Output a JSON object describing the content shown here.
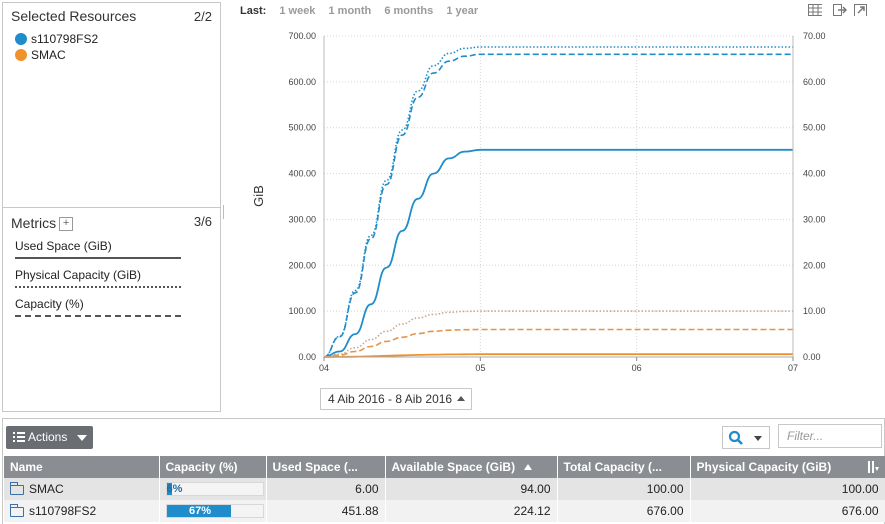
{
  "resources": {
    "title": "Selected Resources",
    "count": "2/2",
    "items": [
      {
        "label": "s110798FS2",
        "color": "#1f8dcc"
      },
      {
        "label": "SMAC",
        "color": "#f0922b"
      }
    ]
  },
  "metrics": {
    "title": "Metrics",
    "count": "3/6",
    "items": [
      {
        "label": "Used Space (GiB)",
        "style": "solid"
      },
      {
        "label": "Physical Capacity (GiB)",
        "style": "dotted"
      },
      {
        "label": "Capacity (%)",
        "style": "dashed"
      }
    ]
  },
  "timerange": {
    "label": "Last:",
    "options": [
      "1 week",
      "1 month",
      "6 months",
      "1 year"
    ]
  },
  "toolbar_icons": [
    "table-view-icon",
    "export-icon",
    "popout-icon"
  ],
  "date_range": "4 Aib 2016 - 8 Aib 2016",
  "chart_data": {
    "type": "line",
    "ylabel_left": "GiB",
    "ylabel_right": "%",
    "ylim_left": [
      0,
      700
    ],
    "ylim_right": [
      0,
      70
    ],
    "yticks_left": [
      "0.00",
      "100.00",
      "200.00",
      "300.00",
      "400.00",
      "500.00",
      "600.00",
      "700.00"
    ],
    "yticks_right": [
      "0.00",
      "10.00",
      "20.00",
      "30.00",
      "40.00",
      "50.00",
      "60.00",
      "70.00"
    ],
    "x_ticks": [
      "04",
      "05",
      "06",
      "07"
    ],
    "x": [
      4.0,
      4.1,
      4.2,
      4.3,
      4.4,
      4.5,
      4.6,
      4.7,
      4.8,
      4.9,
      5.0,
      7.0
    ],
    "series": [
      {
        "resource": "s110798FS2",
        "metric": "Used Space (GiB)",
        "axis": "left",
        "color": "#1f8dcc",
        "dash": "solid",
        "values": [
          0,
          12,
          50,
          115,
          195,
          275,
          345,
          400,
          433,
          448,
          451.88,
          451.88
        ]
      },
      {
        "resource": "s110798FS2",
        "metric": "Physical Capacity (GiB)",
        "axis": "left",
        "color": "#1f8dcc",
        "dash": "dotted",
        "values": [
          0,
          45,
          145,
          265,
          385,
          495,
          580,
          635,
          662,
          673,
          676,
          676
        ]
      },
      {
        "resource": "s110798FS2",
        "metric": "Capacity (%)",
        "axis": "right",
        "color": "#1f8dcc",
        "dash": "dashed",
        "values": [
          0,
          4.4,
          14,
          25.8,
          37.6,
          48.4,
          56.6,
          61.9,
          64.5,
          65.6,
          66,
          66
        ]
      },
      {
        "resource": "SMAC",
        "metric": "Used Space (GiB)",
        "axis": "left",
        "color": "#f0922b",
        "dash": "solid",
        "values": [
          0,
          0.2,
          0.6,
          1.5,
          2.6,
          3.7,
          4.6,
          5.3,
          5.7,
          5.95,
          6,
          6
        ]
      },
      {
        "resource": "SMAC",
        "metric": "Physical Capacity (GiB)",
        "axis": "left",
        "color": "#c9a990",
        "dash": "dotted",
        "values": [
          0,
          6,
          20,
          38,
          56,
          72,
          85,
          93,
          97.5,
          99.4,
          100,
          100
        ]
      },
      {
        "resource": "SMAC",
        "metric": "Capacity (%)",
        "axis": "right",
        "color": "#e8934a",
        "dash": "dashed",
        "values": [
          0,
          0.4,
          1.2,
          2.3,
          3.4,
          4.3,
          5.1,
          5.6,
          5.85,
          5.96,
          6,
          6
        ]
      }
    ]
  },
  "grid": {
    "actions_label": "Actions",
    "filter_placeholder": "Filter...",
    "columns": [
      "Name",
      "Capacity (%)",
      "Used Space (...",
      "Available Space (GiB)",
      "Total Capacity (...",
      "Physical Capacity (GiB)"
    ],
    "rows": [
      {
        "name": "SMAC",
        "capacity_pct": 6,
        "capacity_label": "6%",
        "used": "6.00",
        "available": "94.00",
        "total": "100.00",
        "physical": "100.00"
      },
      {
        "name": "s110798FS2",
        "capacity_pct": 67,
        "capacity_label": "67%",
        "used": "451.88",
        "available": "224.12",
        "total": "676.00",
        "physical": "676.00"
      }
    ]
  }
}
